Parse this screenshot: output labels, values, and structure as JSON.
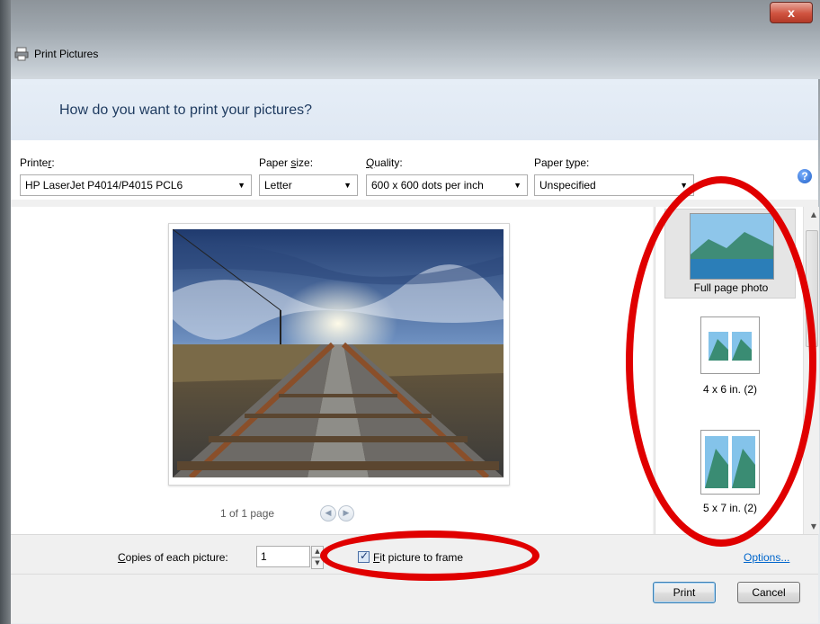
{
  "window": {
    "title": "Print Pictures",
    "close_label": "x"
  },
  "header": {
    "question": "How do you want to print your pictures?"
  },
  "controls": {
    "printer": {
      "label": "Printer:",
      "value": "HP LaserJet P4014/P4015 PCL6"
    },
    "paper_size": {
      "label": "Paper size:",
      "value": "Letter"
    },
    "quality": {
      "label": "Quality:",
      "value": "600 x 600 dots per inch"
    },
    "paper_type": {
      "label": "Paper type:",
      "value": "Unspecified"
    },
    "help_glyph": "?"
  },
  "preview": {
    "page_count": "1 of 1 page"
  },
  "layouts": [
    {
      "label": "Full page photo",
      "selected": true
    },
    {
      "label": "4 x 6 in. (2)",
      "selected": false
    },
    {
      "label": "5 x 7 in. (2)",
      "selected": false
    }
  ],
  "bottom": {
    "copies_label": "Copies of each picture:",
    "copies_value": "1",
    "fit_label": "Fit picture to frame",
    "fit_checked": true,
    "options_label": "Options..."
  },
  "footer": {
    "print_label": "Print",
    "cancel_label": "Cancel"
  },
  "colors": {
    "annotation": "#e00000",
    "header_bg": "#dfe8f3",
    "link": "#0066cc"
  },
  "icons": [
    "printer-icon",
    "help-icon",
    "close-icon",
    "previous-page-icon",
    "next-page-icon",
    "dropdown-arrow-icon"
  ]
}
